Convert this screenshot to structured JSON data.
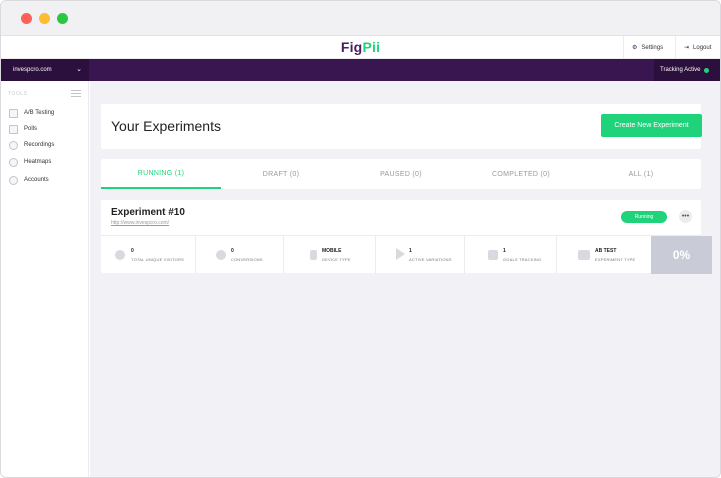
{
  "app": {
    "logo_part1": "Fig",
    "logo_part2": "Pii",
    "settings_label": "Settings",
    "logout_label": "Logout",
    "settings_icon": "gear-icon",
    "logout_icon": "logout-icon"
  },
  "account": {
    "name": "invespcro.com"
  },
  "tracking": {
    "label": "Tracking Active",
    "status_color": "#1fd37a"
  },
  "sidebar": {
    "section_label": "TOOLS",
    "items": [
      {
        "label": "A/B Testing",
        "icon": "ab-testing-icon"
      },
      {
        "label": "Polls",
        "icon": "polls-icon"
      },
      {
        "label": "Recordings",
        "icon": "recordings-icon"
      },
      {
        "label": "Heatmaps",
        "icon": "heatmaps-icon"
      },
      {
        "label": "Accounts",
        "icon": "accounts-icon"
      }
    ]
  },
  "page": {
    "title": "Your Experiments",
    "create_button": "Create New Experiment"
  },
  "tabs": [
    {
      "label": "RUNNING (1)",
      "active": true
    },
    {
      "label": "DRAFT (0)",
      "active": false
    },
    {
      "label": "PAUSED (0)",
      "active": false
    },
    {
      "label": "COMPLETED (0)",
      "active": false
    },
    {
      "label": "ALL (1)",
      "active": false
    }
  ],
  "experiment": {
    "title": "Experiment #10",
    "url": "http://www.invespcro.com/",
    "status": "Running",
    "more": "•••",
    "stats": [
      {
        "value": "0",
        "label": "TOTAL UNIQUE VISITORS",
        "icon": "visitors-icon"
      },
      {
        "value": "0",
        "label": "CONVERSIONS",
        "icon": "refresh-icon"
      },
      {
        "value": "MOBILE",
        "label": "DEVICE TYPE",
        "icon": "mobile-icon"
      },
      {
        "value": "1",
        "label": "ACTIVE VARIATIONS",
        "icon": "play-icon"
      },
      {
        "value": "1",
        "label": "GOALS TRACKING",
        "icon": "flag-icon"
      },
      {
        "value": "AB TEST",
        "label": "EXPERIMENT TYPE",
        "icon": "experiment-type-icon"
      }
    ],
    "conversion_rate": "0%"
  },
  "colors": {
    "brand_purple": "#3a1650",
    "brand_green": "#1fd37a"
  }
}
